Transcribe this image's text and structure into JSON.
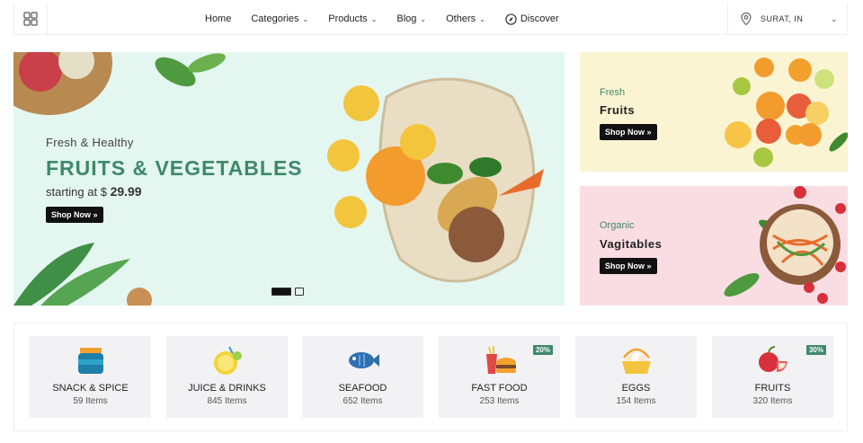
{
  "nav": {
    "menu": [
      {
        "label": "Home",
        "dropdown": false
      },
      {
        "label": "Categories",
        "dropdown": true
      },
      {
        "label": "Products",
        "dropdown": true
      },
      {
        "label": "Blog",
        "dropdown": true
      },
      {
        "label": "Others",
        "dropdown": true
      },
      {
        "label": "Discover",
        "dropdown": false,
        "icon": "compass-icon"
      }
    ],
    "location": "SURAT, IN"
  },
  "hero": {
    "subtitle": "Fresh & Healthy",
    "title": "FRUITS & VEGETABLES",
    "price_prefix": "starting at $",
    "price": "29.99",
    "button": "Shop Now »",
    "slides": 2,
    "active_slide": 1
  },
  "promos": [
    {
      "subtitle": "Fresh",
      "title": "Fruits",
      "button": "Shop Now »"
    },
    {
      "subtitle": "Organic",
      "title": "Vagitables",
      "button": "Shop Now »"
    }
  ],
  "categories": [
    {
      "name": "SNACK & SPICE",
      "count": "59 Items",
      "badge": ""
    },
    {
      "name": "JUICE & DRINKS",
      "count": "845 Items",
      "badge": ""
    },
    {
      "name": "SEAFOOD",
      "count": "652 Items",
      "badge": ""
    },
    {
      "name": "FAST FOOD",
      "count": "253 Items",
      "badge": "20%"
    },
    {
      "name": "EGGS",
      "count": "154 Items",
      "badge": ""
    },
    {
      "name": "FRUITS",
      "count": "320 Items",
      "badge": "30%"
    }
  ],
  "colors": {
    "accent": "#3d8a6a",
    "hero_bg": "#e4f6f0",
    "promo1_bg": "#fbf4d3",
    "promo2_bg": "#f9dde2"
  }
}
